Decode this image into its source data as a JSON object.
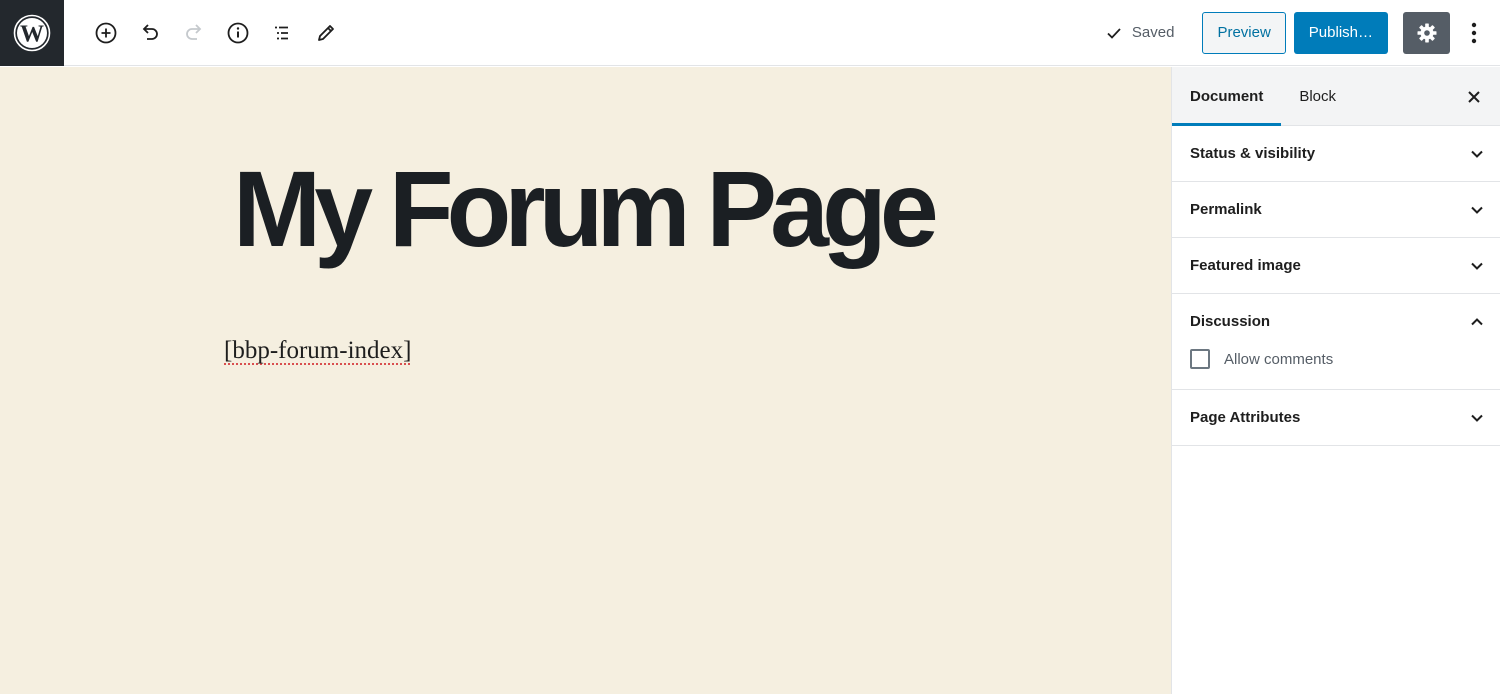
{
  "app": {
    "logo": "wordpress-logo"
  },
  "toolbar": {
    "tools": [
      {
        "name": "add-block",
        "icon": "plus-circle-icon",
        "enabled": true
      },
      {
        "name": "undo",
        "icon": "undo-icon",
        "enabled": true
      },
      {
        "name": "redo",
        "icon": "redo-icon",
        "enabled": false
      },
      {
        "name": "content-structure",
        "icon": "info-icon",
        "enabled": true
      },
      {
        "name": "block-navigation",
        "icon": "list-icon",
        "enabled": true
      },
      {
        "name": "tools",
        "icon": "pencil-icon",
        "enabled": true
      }
    ],
    "saved_label": "Saved",
    "preview_label": "Preview",
    "publish_label": "Publish…",
    "settings_icon": "gear-icon",
    "more_icon": "vertical-ellipsis-icon"
  },
  "editor": {
    "title": "My Forum Page",
    "paragraph": "[bbp-forum-index]",
    "background": "#f5efe0"
  },
  "sidebar": {
    "tabs": [
      {
        "label": "Document",
        "active": true
      },
      {
        "label": "Block",
        "active": false
      }
    ],
    "panels": [
      {
        "title": "Status & visibility",
        "expanded": false
      },
      {
        "title": "Permalink",
        "expanded": false
      },
      {
        "title": "Featured image",
        "expanded": false
      },
      {
        "title": "Discussion",
        "expanded": true,
        "options": [
          {
            "label": "Allow comments",
            "checked": false
          }
        ]
      },
      {
        "title": "Page Attributes",
        "expanded": false
      }
    ]
  },
  "colors": {
    "accent": "#007cba",
    "topbar_logo_bg": "#23282d",
    "settings_btn": "#555d66"
  }
}
